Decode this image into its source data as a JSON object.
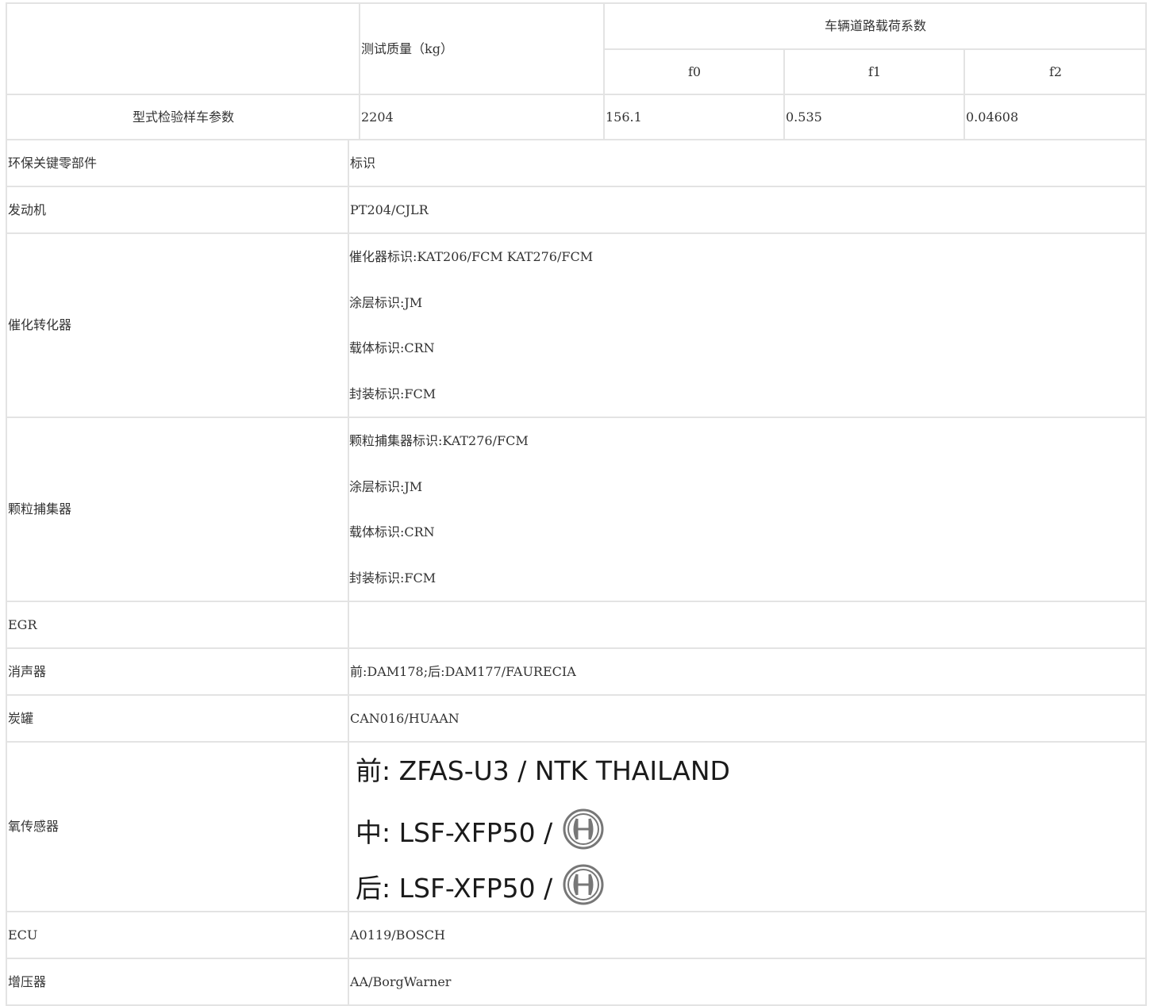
{
  "header_table": {
    "col_mass_header": "测试质量（kg）",
    "col_load_header": "车辆道路载荷系数",
    "sub_headers": [
      "f0",
      "f1",
      "f2"
    ],
    "row_label": "型式检验样车参数",
    "mass_value": "2204",
    "f0_value": "156.1",
    "f1_value": "0.535",
    "f2_value": "0.04608"
  },
  "parts_table": {
    "header": {
      "label": "环保关键零部件",
      "value": "标识"
    },
    "engine": {
      "label": "发动机",
      "value": "PT204/CJLR"
    },
    "catalyst": {
      "label": "催化转化器",
      "lines": [
        "催化器标识:KAT206/FCM KAT276/FCM",
        "涂层标识:JM",
        "载体标识:CRN",
        "封装标识:FCM"
      ]
    },
    "particulate": {
      "label": "颗粒捕集器",
      "lines": [
        "颗粒捕集器标识:KAT276/FCM",
        "涂层标识:JM",
        "载体标识:CRN",
        "封装标识:FCM"
      ]
    },
    "egr": {
      "label": "EGR",
      "value": ""
    },
    "muffler": {
      "label": "消声器",
      "value": "前:DAM178;后:DAM177/FAURECIA"
    },
    "canister": {
      "label": "炭罐",
      "value": "CAN016/HUAAN"
    },
    "oxygen": {
      "label": "氧传感器",
      "front": "前: ZFAS-U3 / NTK THAILAND",
      "middle": "中: LSF-XFP50 /",
      "rear": "后: LSF-XFP50 /",
      "icon": "bosch-logo-icon"
    },
    "ecu": {
      "label": "ECU",
      "value": "A0119/BOSCH"
    },
    "turbo": {
      "label": "增压器",
      "value": "AA/BorgWarner"
    }
  }
}
